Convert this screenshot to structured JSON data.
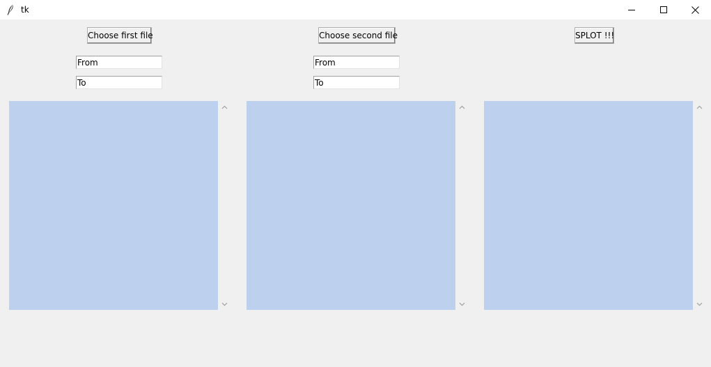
{
  "window": {
    "title": "tk",
    "icons": {
      "app": "feather-icon",
      "minimize": "minimize-icon",
      "maximize": "maximize-icon",
      "close": "close-icon"
    }
  },
  "file1": {
    "button_label": "Choose first file",
    "from_value": "From",
    "to_value": "To"
  },
  "file2": {
    "button_label": "Choose second file",
    "from_value": "From",
    "to_value": "To"
  },
  "splot": {
    "button_label": "SPLOT !!!"
  },
  "colors": {
    "listbox_background": "#bdd1ee",
    "window_background": "#f0f0f0",
    "titlebar_background": "#ffffff"
  }
}
